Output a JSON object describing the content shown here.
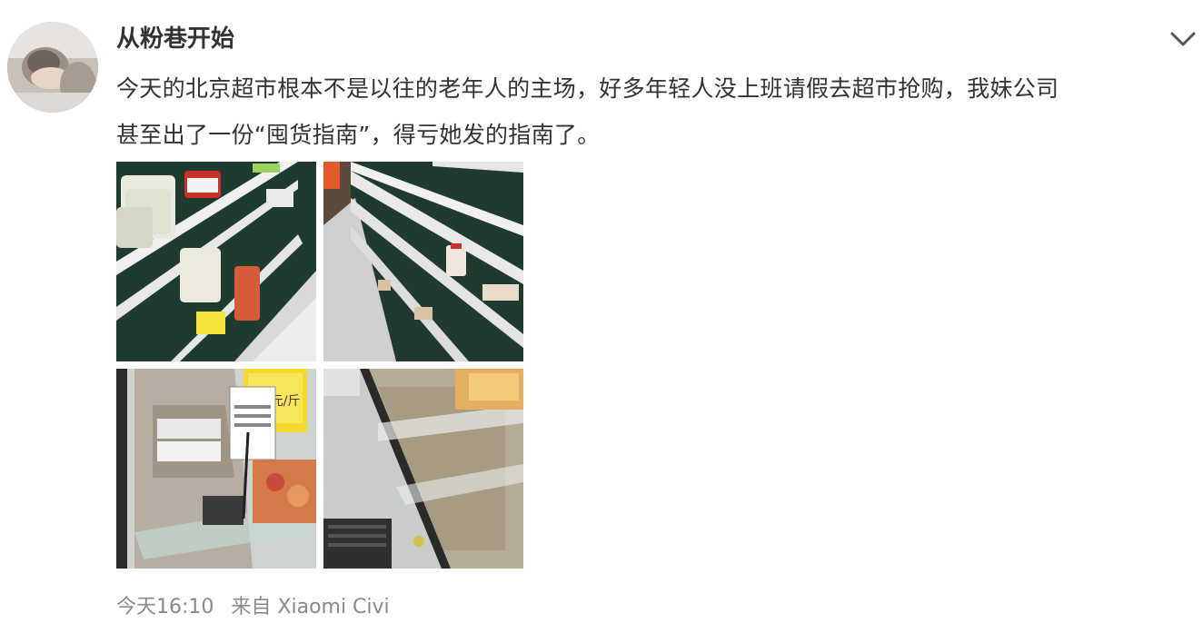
{
  "user": {
    "name": "从粉巷开始"
  },
  "post": {
    "text_lines": [
      "今天的北京超市根本不是以往的老年人的主场，好多年轻人没上班请假去超市抢购，我妹公司",
      "甚至出了一份“囤货指南”，得亏她发的指南了。"
    ],
    "images": [
      {
        "id": "photo-1"
      },
      {
        "id": "photo-2"
      },
      {
        "id": "photo-3",
        "sign_text": "9.9元/斤"
      },
      {
        "id": "photo-4"
      }
    ]
  },
  "meta": {
    "time": "今天16:10",
    "source": "来自 Xiaomi Civi"
  },
  "icons": {
    "menu": "chevron-down-icon"
  },
  "colors": {
    "text": "#333333",
    "meta": "#8a8a8a",
    "background": "#ffffff"
  }
}
